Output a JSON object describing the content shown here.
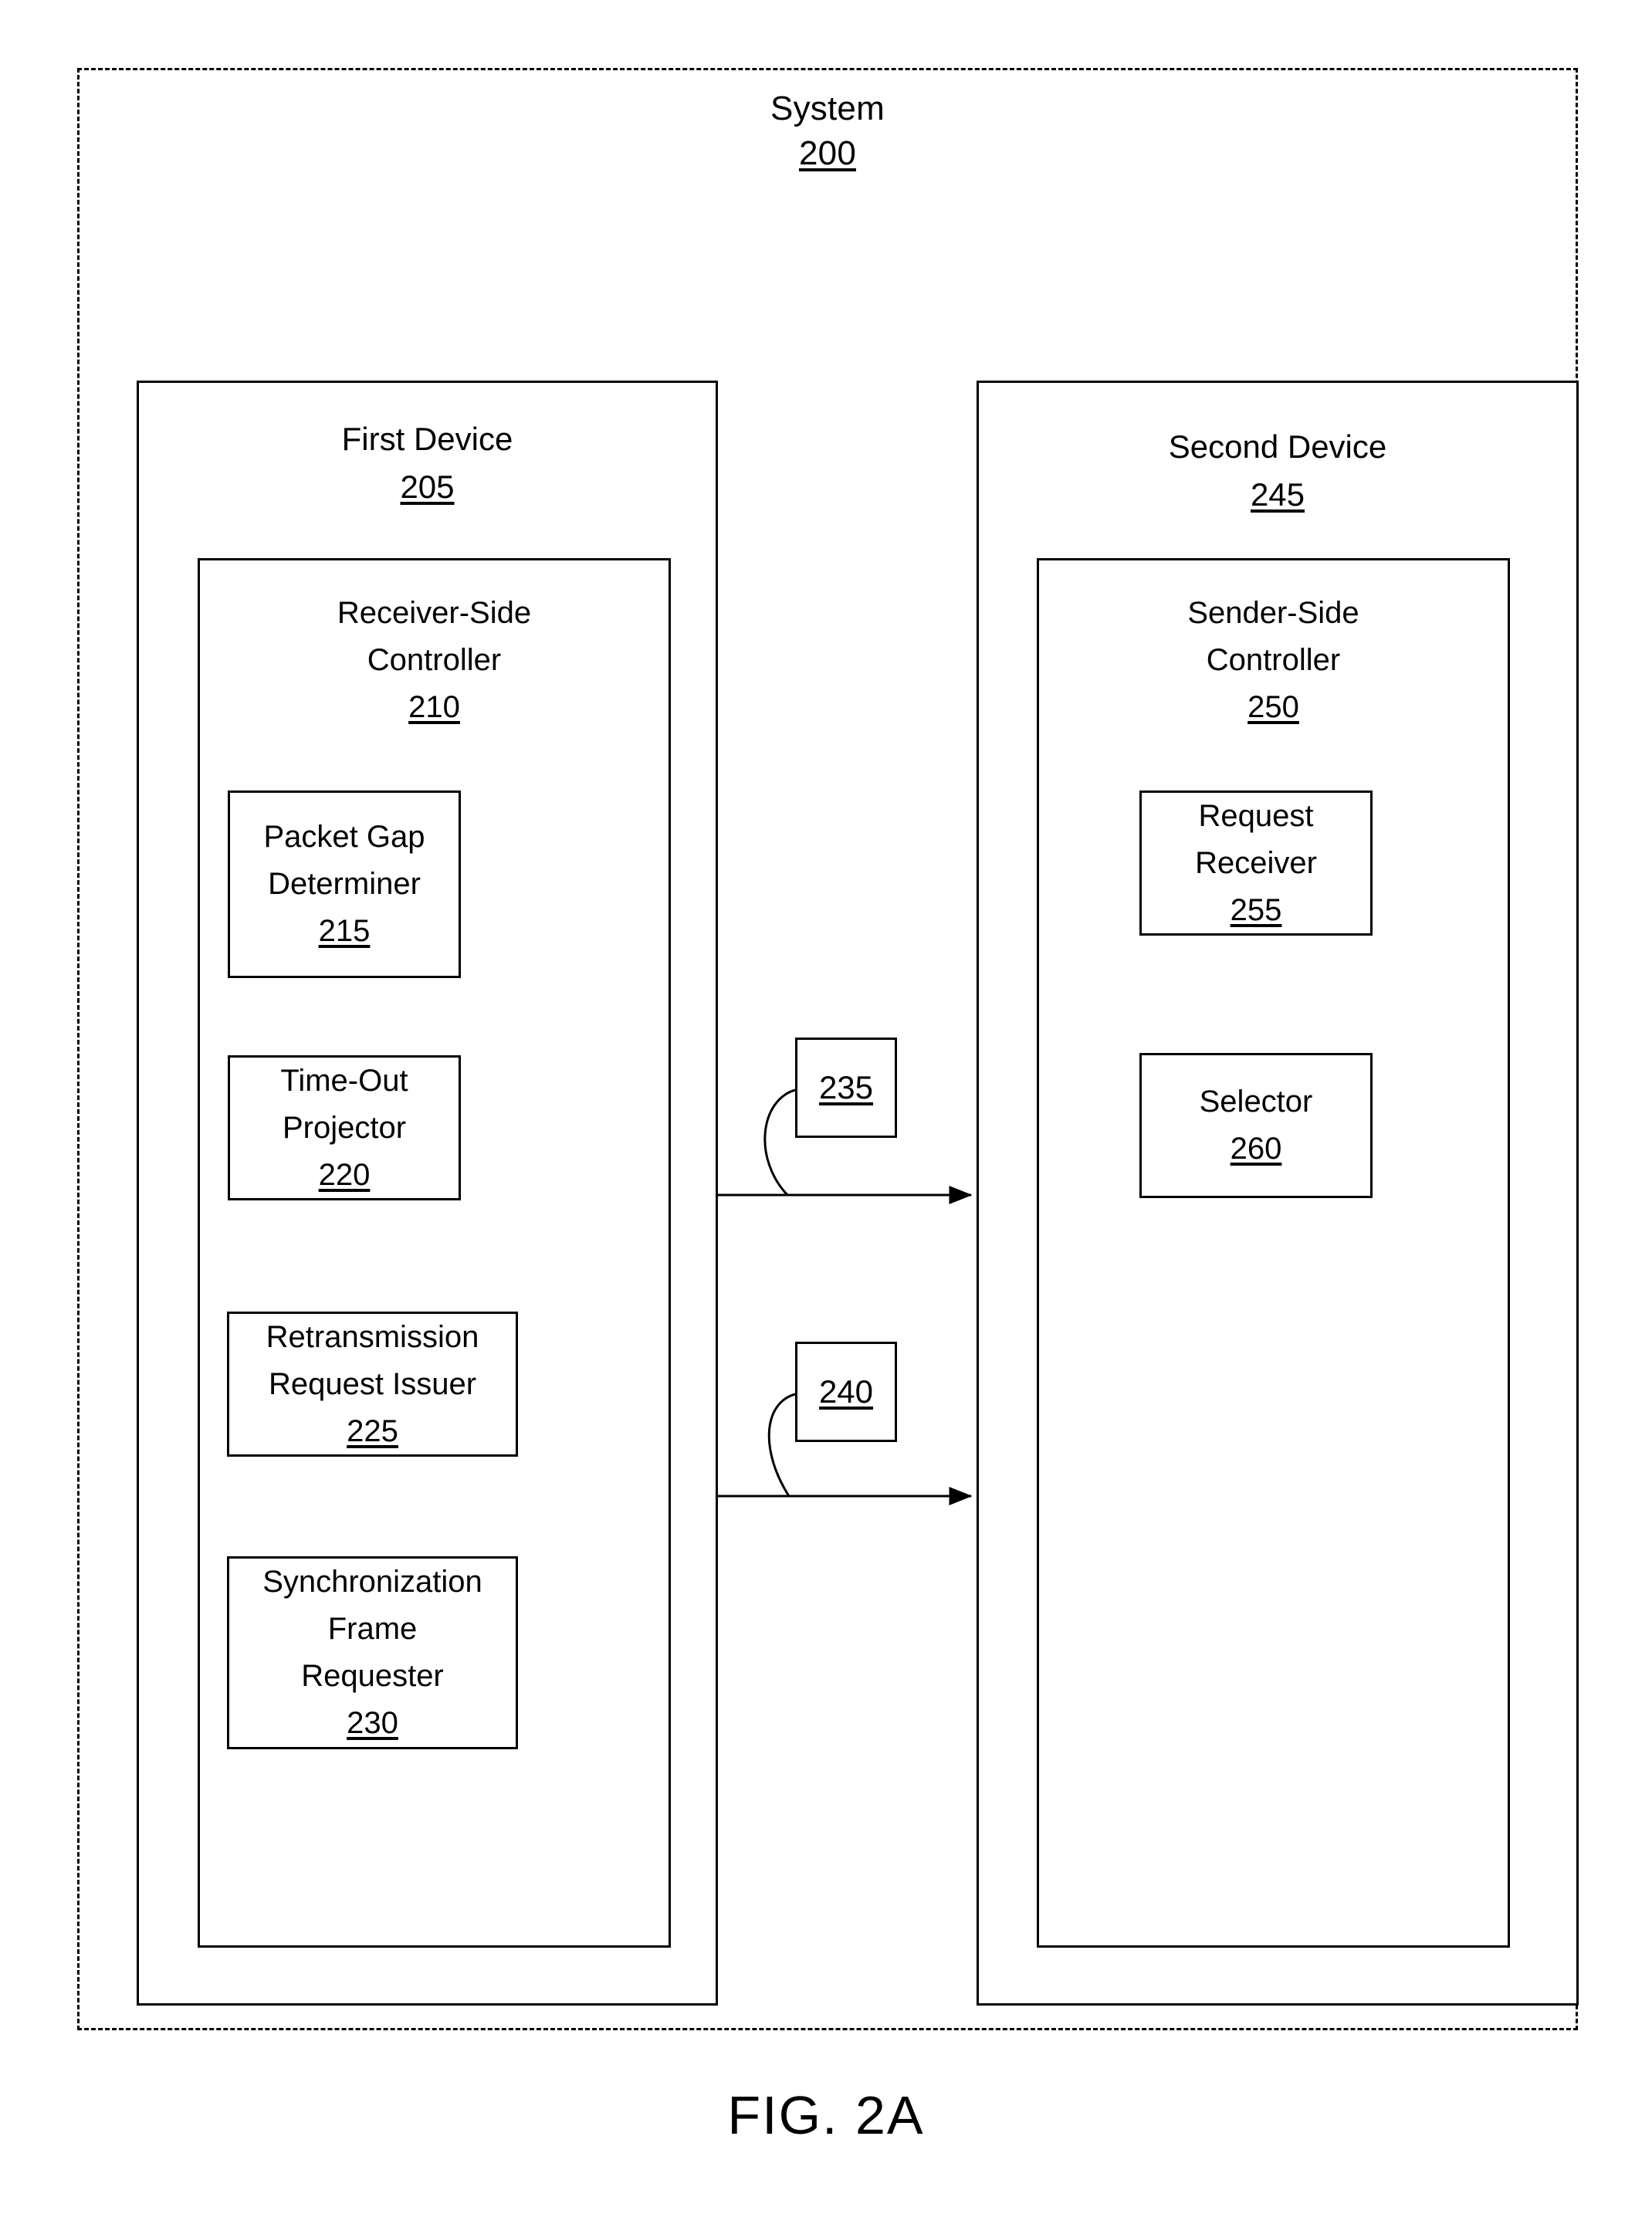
{
  "figure": {
    "caption": "FIG. 2A"
  },
  "system": {
    "title": "System",
    "ref": "200"
  },
  "first_device": {
    "title": "First Device",
    "ref": "205",
    "controller": {
      "title": "Receiver-Side\nController",
      "ref": "210",
      "components": [
        {
          "label": "Packet Gap\nDeterminer",
          "ref": "215"
        },
        {
          "label": "Time-Out\nProjector",
          "ref": "220"
        },
        {
          "label": "Retransmission\nRequest Issuer",
          "ref": "225"
        },
        {
          "label": "Synchronization\nFrame\nRequester",
          "ref": "230"
        }
      ]
    }
  },
  "second_device": {
    "title": "Second Device",
    "ref": "245",
    "controller": {
      "title": "Sender-Side\nController",
      "ref": "250",
      "components": [
        {
          "label": "Request\nReceiver",
          "ref": "255"
        },
        {
          "label": "Selector",
          "ref": "260"
        }
      ]
    }
  },
  "connectors": [
    {
      "ref": "235",
      "from": "first_device",
      "to": "second_device"
    },
    {
      "ref": "240",
      "from": "first_device",
      "to": "second_device"
    }
  ],
  "colors": {
    "stroke": "#000000",
    "background": "#ffffff"
  }
}
